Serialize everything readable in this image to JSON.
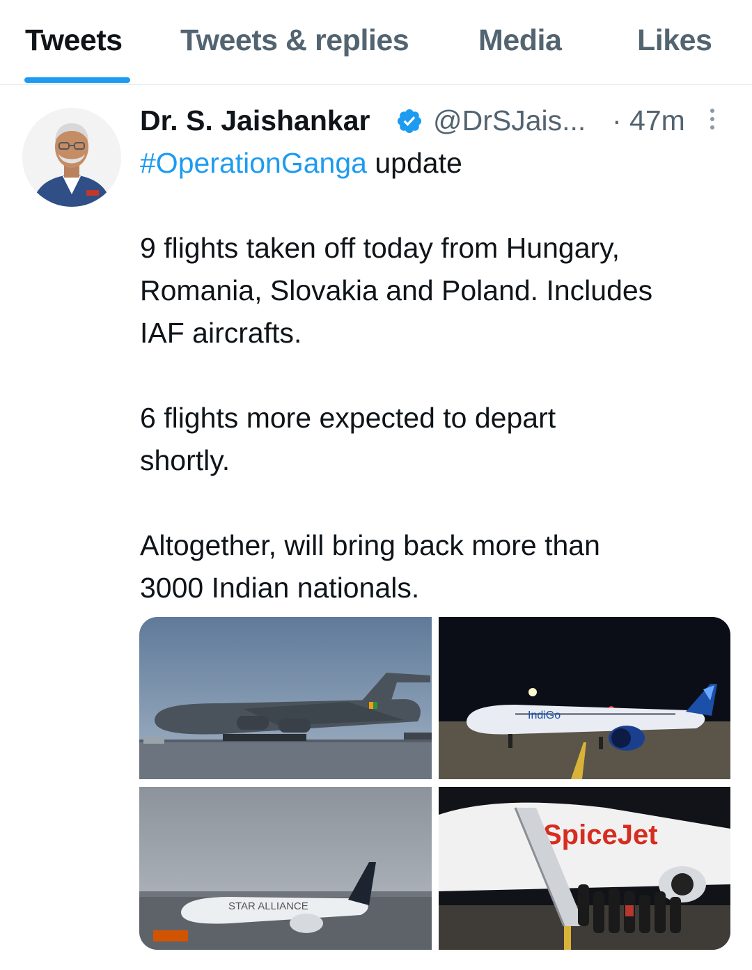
{
  "tabs": [
    {
      "label": "Tweets",
      "active": true
    },
    {
      "label": "Tweets & replies",
      "active": false
    },
    {
      "label": "Media",
      "active": false
    },
    {
      "label": "Likes",
      "active": false
    }
  ],
  "tweet": {
    "author_name": "Dr. S. Jaishankar",
    "verified": true,
    "handle": "@DrSJais...",
    "time": "· 47m",
    "hashtag": "#OperationGanga",
    "first_line_rest": " update",
    "paragraphs": [
      "9 flights taken off today from Hungary,\nRomania, Slovakia and Poland. Includes\nIAF aircrafts.",
      "6 flights more expected to depart\nshortly.",
      "Altogether, will bring back more than\n3000 Indian nationals."
    ],
    "media": [
      {
        "icon": "iaf-transport-aircraft-photo"
      },
      {
        "icon": "indigo-aircraft-night-photo",
        "label": "IndiGo"
      },
      {
        "icon": "star-alliance-aircraft-photo",
        "label": "STAR ALLIANCE"
      },
      {
        "icon": "spicejet-aircraft-boarding-photo",
        "label": "SpiceJet"
      }
    ]
  },
  "colors": {
    "accent": "#1d9bf0",
    "text_primary": "#0f1419",
    "text_secondary": "#536471"
  }
}
